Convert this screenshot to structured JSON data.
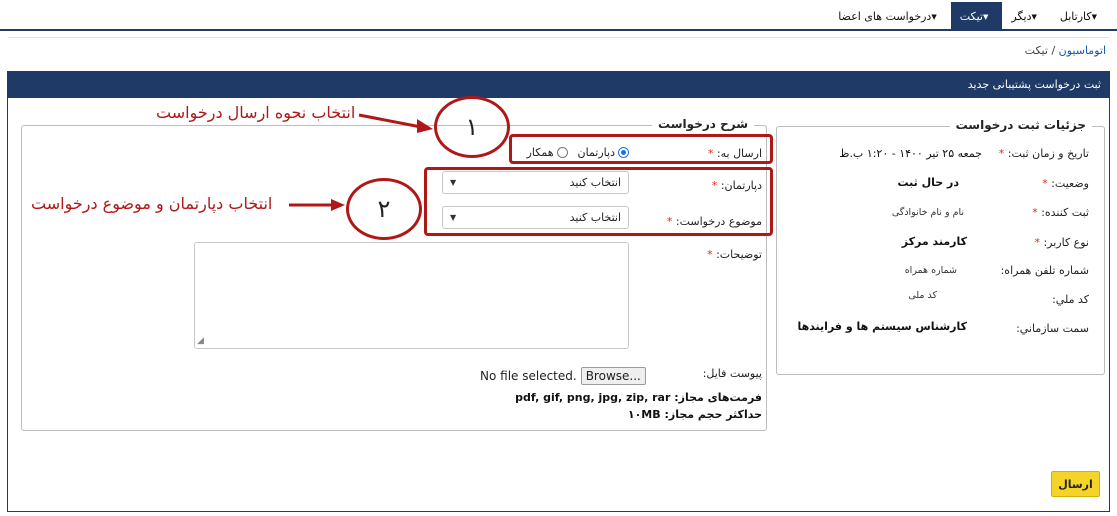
{
  "menu": {
    "items": [
      {
        "label": "کارتابل",
        "active": false
      },
      {
        "label": "دیگر",
        "active": false
      },
      {
        "label": "تیکت",
        "active": true
      },
      {
        "label": "درخواست های اعضا",
        "active": false
      }
    ]
  },
  "breadcrumb": {
    "link": "اتوماسیون",
    "sep": "/",
    "current": "تیکت"
  },
  "panel": {
    "title": "ثبت درخواست پشتیبانی جدید"
  },
  "details": {
    "legend": "جزئیات ثبت درخواست",
    "rows": [
      {
        "label": "تاریخ و زمان ثبت:",
        "required": "*",
        "value": "جمعه ۲۵ تیر ۱۴۰۰ - ۱:۲۰ ب.ظ"
      },
      {
        "label": "وضعیت:",
        "required": "*",
        "value": "در حال ثبت"
      },
      {
        "label": "ثبت کننده:",
        "required": "*",
        "value": "نام و نام خانوادگی"
      },
      {
        "label": "نوع کاربر:",
        "required": "*",
        "value": "کارمند مرکز"
      },
      {
        "label": "شماره تلفن همراه:",
        "value": "شماره همراه"
      },
      {
        "label": "کد ملي:",
        "value": "کد ملی"
      },
      {
        "label": "سمت سازماني:",
        "value": "کارشناس سیستم ها و فرایندها"
      }
    ]
  },
  "request": {
    "legend": "شرح درخواست",
    "send_to_label": "ارسال به:",
    "required": "*",
    "radio_department": "دپارتمان",
    "radio_colleague": "همکار",
    "department_label": "دپارتمان:",
    "subject_label": "موضوع درخواست:",
    "select_placeholder": "انتخاب کنید",
    "description_label": "توضیحات:",
    "attachment_label": "پیوست فایل:",
    "browse_label": "Browse...",
    "no_file": "No file selected.",
    "formats": "فرمت‌های مجاز: pdf, gif, png, jpg, zip, rar",
    "max_size": "حداکثر حجم مجاز: ۱۰MB"
  },
  "submit_label": "ارسال",
  "annotations": {
    "circle1": "۱",
    "circle2": "۲",
    "text1": "انتخاب نحوه ارسال درخواست",
    "text2": "انتخاب دپارتمان و موضوع درخواست"
  },
  "colors": {
    "accent": "#1f3a66",
    "annotation": "#b01818",
    "submit": "#f5d42a",
    "required": "#d9281f"
  }
}
